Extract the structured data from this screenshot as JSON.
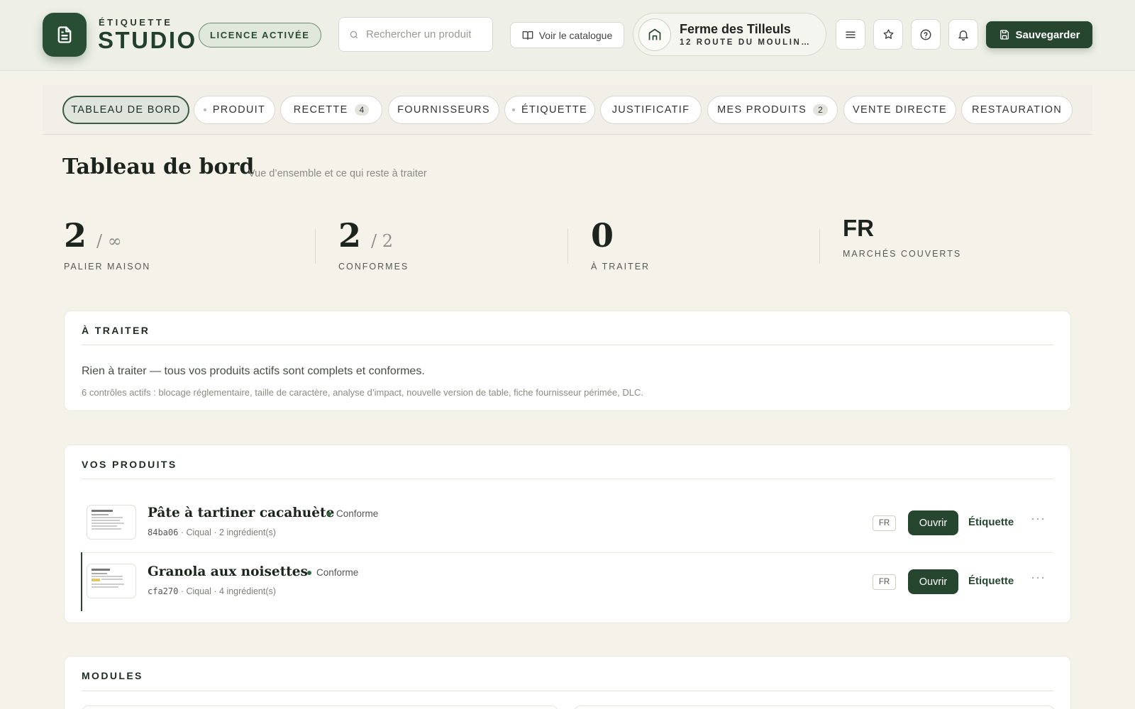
{
  "header": {
    "brand_small": "ÉTIQUETTE",
    "brand_big": "STUDIO",
    "license_label": "LICENCE ACTIVÉE",
    "search_placeholder": "Rechercher un produit",
    "catalog_label": "Voir le catalogue",
    "farm_name": "Ferme des Tilleuls",
    "farm_address": "12 ROUTE DU MOULIN…",
    "save_label": "Sauvegarder",
    "icons": [
      "menu-icon",
      "star-icon",
      "help-icon",
      "bell-icon"
    ]
  },
  "tabs": [
    {
      "label": "TABLEAU DE BORD",
      "active": true
    },
    {
      "label": "PRODUIT"
    },
    {
      "label": "RECETTE",
      "count": "4"
    },
    {
      "label": "FOURNISSEURS"
    },
    {
      "label": "ÉTIQUETTE"
    },
    {
      "label": "JUSTIFICATIF"
    },
    {
      "label": "MES PRODUITS",
      "count": "2"
    },
    {
      "label": "VENTE DIRECTE"
    },
    {
      "label": "RESTAURATION"
    }
  ],
  "page": {
    "title": "Tableau de bord",
    "subtitle": "Vue d’ensemble et ce qui reste à traiter"
  },
  "stats": [
    {
      "value": "2",
      "denominator": "/ ∞",
      "label": "PALIER MAISON"
    },
    {
      "value": "2",
      "denominator": "/ 2",
      "label": "CONFORMES"
    },
    {
      "value": "0",
      "label": "À TRAITER"
    },
    {
      "value": "FR",
      "label": "MARCHÉS COUVERTS"
    }
  ],
  "todo": {
    "heading": "À TRAITER",
    "message": "Rien à traiter — tous vos produits actifs sont complets et conformes.",
    "checks": "6 contrôles actifs : blocage réglementaire, taille de caractère, analyse d’impact, nouvelle version de table, fiche fournisseur périmée, DLC."
  },
  "products": {
    "heading": "VOS PRODUITS",
    "items": [
      {
        "name": "Pâte à tartiner cacahuète",
        "status": "Conforme",
        "code": "84ba06",
        "source": "Ciqual",
        "ingredients": "2 ingrédient(s)",
        "market": "FR",
        "open_label": "Ouvrir",
        "label_link": "Étiquette",
        "more": "···"
      },
      {
        "name": "Granola aux noisettes",
        "status": "Conforme",
        "code": "cfa270",
        "source": "Ciqual",
        "ingredients": "4 ingrédient(s)",
        "market": "FR",
        "open_label": "Ouvrir",
        "label_link": "Étiquette",
        "more": "···"
      }
    ]
  },
  "modules": {
    "heading": "MODULES"
  },
  "colors": {
    "accent": "#27462f",
    "background": "#f5f2ea",
    "status_ok": "#2f6b3d"
  }
}
